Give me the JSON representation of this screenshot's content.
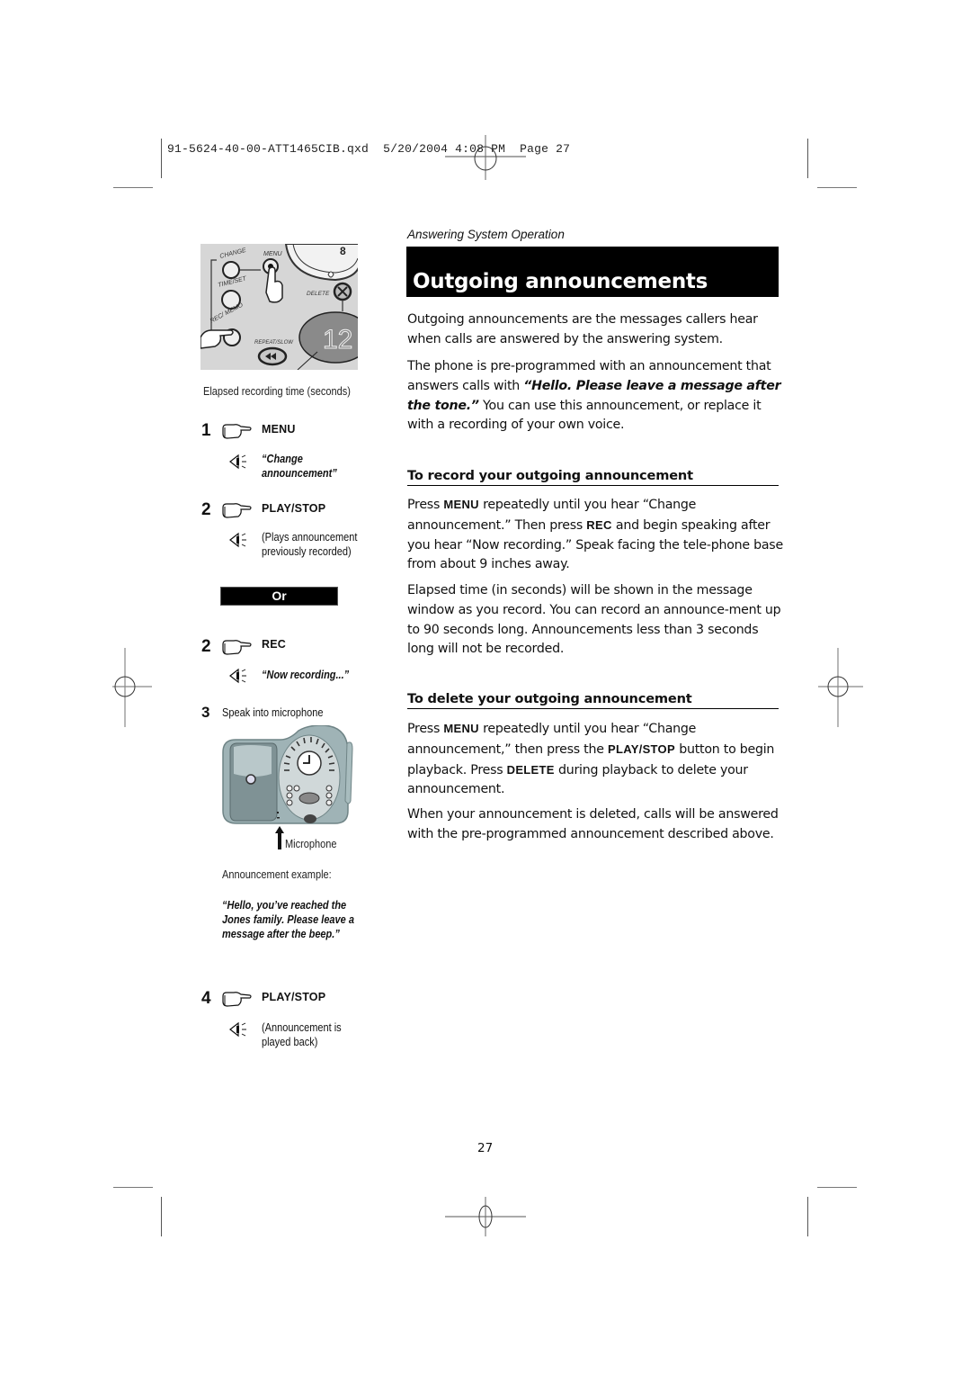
{
  "print_slug": {
    "file": "91-5624-40-00-ATT1465CIB.qxd",
    "date": "5/20/2004",
    "time": "4:08 PM",
    "page_label": "Page 27"
  },
  "illustration_top": {
    "buttons": [
      "CHANGE",
      "MENU",
      "TIME/SET",
      "REC/ MEMO",
      "DELETE",
      "REPEAT/SLOW"
    ],
    "display_value": "12",
    "caption": "Elapsed recording time (seconds)"
  },
  "steps": [
    {
      "number": "1",
      "key": "MENU",
      "response": "“Change announcement”",
      "response_style": "italic-bold"
    },
    {
      "number": "2",
      "key": "PLAY/STOP",
      "response": "(Plays announcement previously recorded)",
      "response_style": "plain"
    },
    {
      "number": "2",
      "key": "REC",
      "response": "“Now recording...”",
      "response_style": "italic-bold"
    },
    {
      "number": "3",
      "text": "Speak into microphone"
    },
    {
      "number": "4",
      "key": "PLAY/STOP",
      "response": "(Announcement is played back)",
      "response_style": "plain"
    }
  ],
  "or_label": "Or",
  "phone_illustration": {
    "callout": "Microphone"
  },
  "announcement_example": {
    "label": "Announcement example:",
    "text": "“Hello, you’ve reached the Jones family. Please leave a message after the beep.”"
  },
  "main": {
    "section_label": "Answering System Operation",
    "title": "Outgoing announcements",
    "intro": "Outgoing announcements are the messages callers hear when calls are answered by the answering system.",
    "preprogrammed": {
      "before": "The phone is pre-programmed with an announcement that answers calls with ",
      "quote": "“Hello. Please leave a message after the tone.”",
      "after": " You can use this announcement, or replace it with a recording of your own voice."
    },
    "record_heading": "To record your outgoing announcement",
    "record_para": {
      "t1": "Press ",
      "k1": "MENU",
      "t2": " repeatedly until you hear “Change announcement.” Then press ",
      "k2": "REC",
      "t3": " and begin speaking after you hear “Now recording.” Speak facing the tele-phone base from about 9 inches away."
    },
    "elapsed_para": "Elapsed time (in seconds) will be shown in the message window as you record. You can record an announce-ment up to 90 seconds long. Announcements less than 3 seconds long will not be recorded.",
    "delete_heading": "To delete your outgoing announcement",
    "delete_para": {
      "t1": "Press ",
      "k1": "MENU",
      "t2": " repeatedly until you hear “Change announcement,” then press the ",
      "k2": "PLAY/STOP",
      "t3": " button to begin playback. Press ",
      "k3": "DELETE",
      "t4": " during playback to delete your announcement."
    },
    "deleted_para": "When your announcement is deleted, calls will be answered with the pre-programmed announcement described above."
  },
  "page_number": "27"
}
